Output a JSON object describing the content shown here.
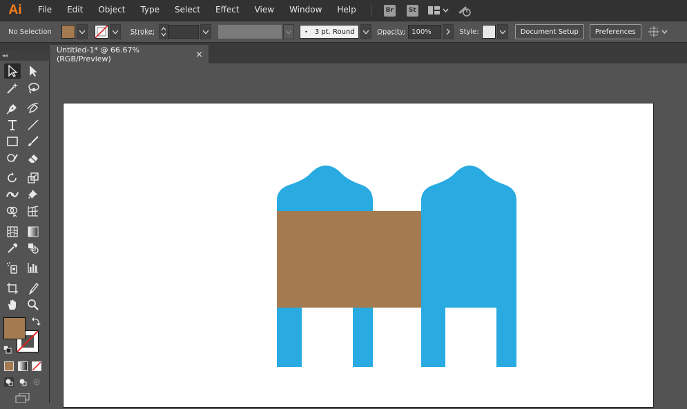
{
  "app": {
    "logo": "Ai"
  },
  "menubar": {
    "items": [
      "File",
      "Edit",
      "Object",
      "Type",
      "Select",
      "Effect",
      "View",
      "Window",
      "Help"
    ],
    "bridge_badge": "Br",
    "stock_badge": "St"
  },
  "controlbar": {
    "selection": "No Selection",
    "fill_color": "#a47b50",
    "stroke_label": "Stroke:",
    "brush_value": "3 pt. Round",
    "opacity_label": "Opacity:",
    "opacity_value": "100%",
    "style_label": "Style:",
    "document_setup": "Document Setup",
    "preferences": "Preferences"
  },
  "document": {
    "tab_title": "Untitled-1* @ 66.67% (RGB/Preview)",
    "close_glyph": "×"
  },
  "tools_panel": {
    "collapse_glyph": "◂◂",
    "fill_color": "#a47b50"
  },
  "artwork": {
    "blue": "#29abe2",
    "brown": "#a47b50"
  }
}
